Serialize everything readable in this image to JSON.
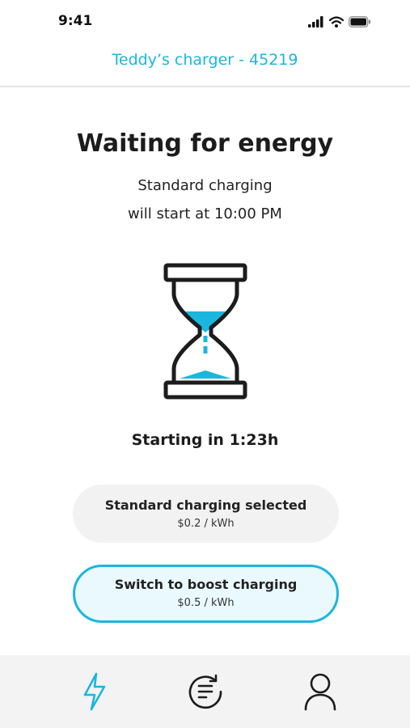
{
  "status_bar": {
    "time": "9:41"
  },
  "header": {
    "title": "Teddy’s charger - 45219"
  },
  "main": {
    "title": "Waiting for energy",
    "subtitle_line1": "Standard charging",
    "subtitle_line2": "will start at 10:00 PM",
    "illustration_icon": "hourglass-icon",
    "countdown": "Starting in 1:23h"
  },
  "options": [
    {
      "title": "Standard charging selected",
      "price": "$0.2 / kWh"
    },
    {
      "title": "Switch to boost charging",
      "price": "$0.5 / kWh"
    }
  ],
  "nav": {
    "items": [
      {
        "icon": "lightning-icon",
        "active": true
      },
      {
        "icon": "history-icon",
        "active": false
      },
      {
        "icon": "profile-icon",
        "active": false
      }
    ]
  },
  "colors": {
    "accent": "#1bb6de",
    "text": "#1c1c1c",
    "card_bg": "#f2f2f2",
    "boost_bg": "#e9f9fd",
    "nav_bg": "#f3f3f3"
  }
}
